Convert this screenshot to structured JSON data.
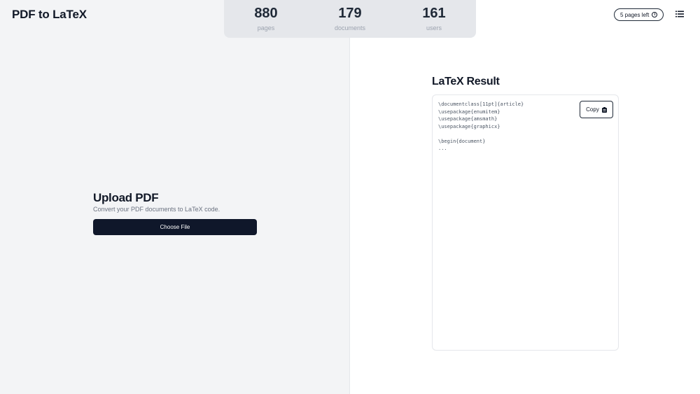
{
  "app": {
    "title": "PDF to LaTeX"
  },
  "stats": [
    {
      "value": "880",
      "label": "pages"
    },
    {
      "value": "179",
      "label": "documents"
    },
    {
      "value": "161",
      "label": "users"
    }
  ],
  "header": {
    "pages_left_badge": "5 pages left",
    "info_icon": "info-icon",
    "menu_icon": "list-menu-icon"
  },
  "upload": {
    "title": "Upload PDF",
    "subtitle": "Convert your PDF documents to LaTeX code.",
    "button_label": "Choose File"
  },
  "result": {
    "title": "LaTeX Result",
    "copy_label": "Copy",
    "copy_icon": "clipboard-icon",
    "code_lines": [
      "\\documentclass[11pt]{article}",
      "\\usepackage{enumitem}",
      "\\usepackage{amsmath}",
      "\\usepackage{graphicx}",
      "",
      "\\begin{document}",
      "..."
    ]
  },
  "colors": {
    "left_pane_bg": "#f3f4f6",
    "stats_bg": "#e5e7eb",
    "primary_button": "#0f172a"
  }
}
